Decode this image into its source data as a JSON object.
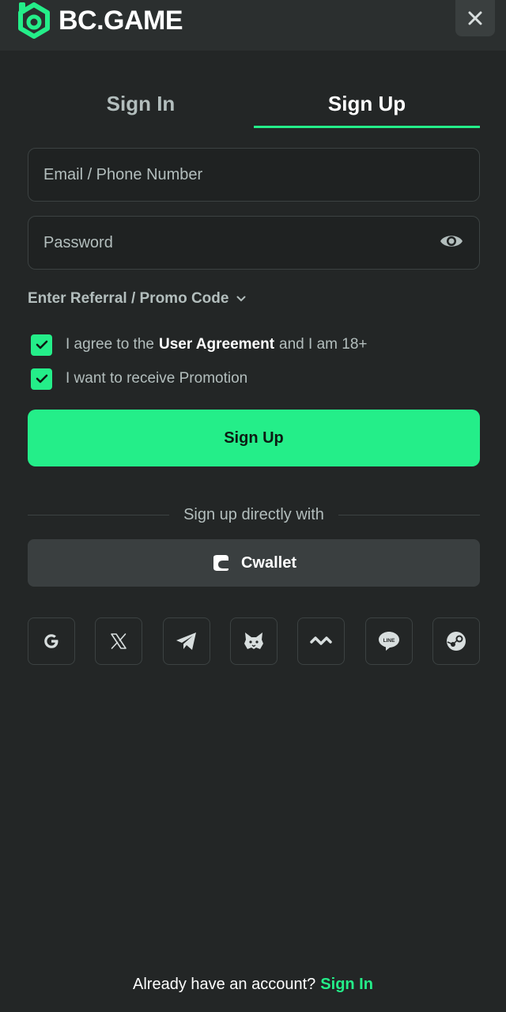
{
  "brand": {
    "name": "BC.GAME",
    "accent": "#24ee89"
  },
  "tabs": [
    {
      "label": "Sign In",
      "active": false
    },
    {
      "label": "Sign Up",
      "active": true
    }
  ],
  "form": {
    "email_placeholder": "Email / Phone Number",
    "email_value": "",
    "password_placeholder": "Password",
    "password_value": "",
    "password_icon": "eye-icon",
    "promo_label": "Enter Referral / Promo Code",
    "agree": {
      "prefix": "I agree to the",
      "link": "User Agreement",
      "suffix": "and I am 18+",
      "checked": true
    },
    "promotion": {
      "label": "I want to receive Promotion",
      "checked": true
    },
    "submit_label": "Sign Up"
  },
  "social": {
    "divider_label": "Sign up directly with",
    "cwallet_label": "Cwallet",
    "providers": [
      "google-icon",
      "x-icon",
      "telegram-icon",
      "metamask-icon",
      "walletconnect-icon",
      "line-icon",
      "steam-icon"
    ],
    "line_text": "LINE"
  },
  "footer": {
    "prompt": "Already have an account?",
    "link": "Sign In"
  }
}
